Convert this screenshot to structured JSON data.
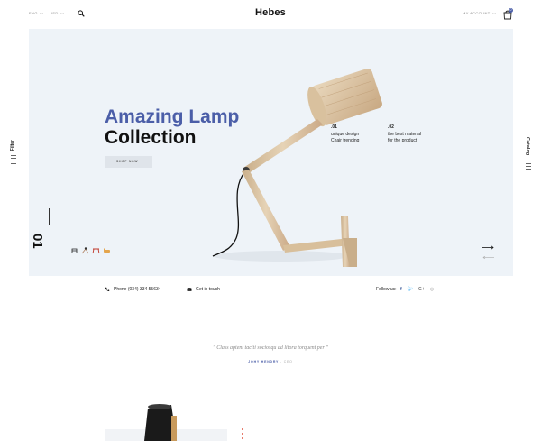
{
  "header": {
    "language": "ENG",
    "currency": "USD",
    "logo": "Hebes",
    "account": "MY ACCOUNT",
    "cart_count": "0"
  },
  "side": {
    "left_label": "Filter",
    "right_label": "Catalog"
  },
  "hero": {
    "title_line1": "Amazing Lamp",
    "title_line2": "Collection",
    "cta": "SHOP NOW",
    "features": [
      {
        "num": ".01",
        "line1": "unique design",
        "line2": "Chair trending"
      },
      {
        "num": ".02",
        "line1": "the best material",
        "line2": "for the product"
      }
    ],
    "slide_number": "01"
  },
  "contact": {
    "phone": "Phone (034) 334 55634",
    "touch": "Get in touch",
    "follow": "Follow us:",
    "socials": [
      "facebook-icon",
      "twitter-icon",
      "google-plus-icon",
      "instagram-icon"
    ]
  },
  "testimonial": {
    "quote": "\" Class aptent taciti sociosqu ad litora torquent per \"",
    "name": "JOHY HENDRY",
    "role": " - CEO"
  },
  "colors": {
    "accent": "#4b5ea8",
    "hero_bg": "#eef3f8",
    "red": "#e0533f"
  }
}
